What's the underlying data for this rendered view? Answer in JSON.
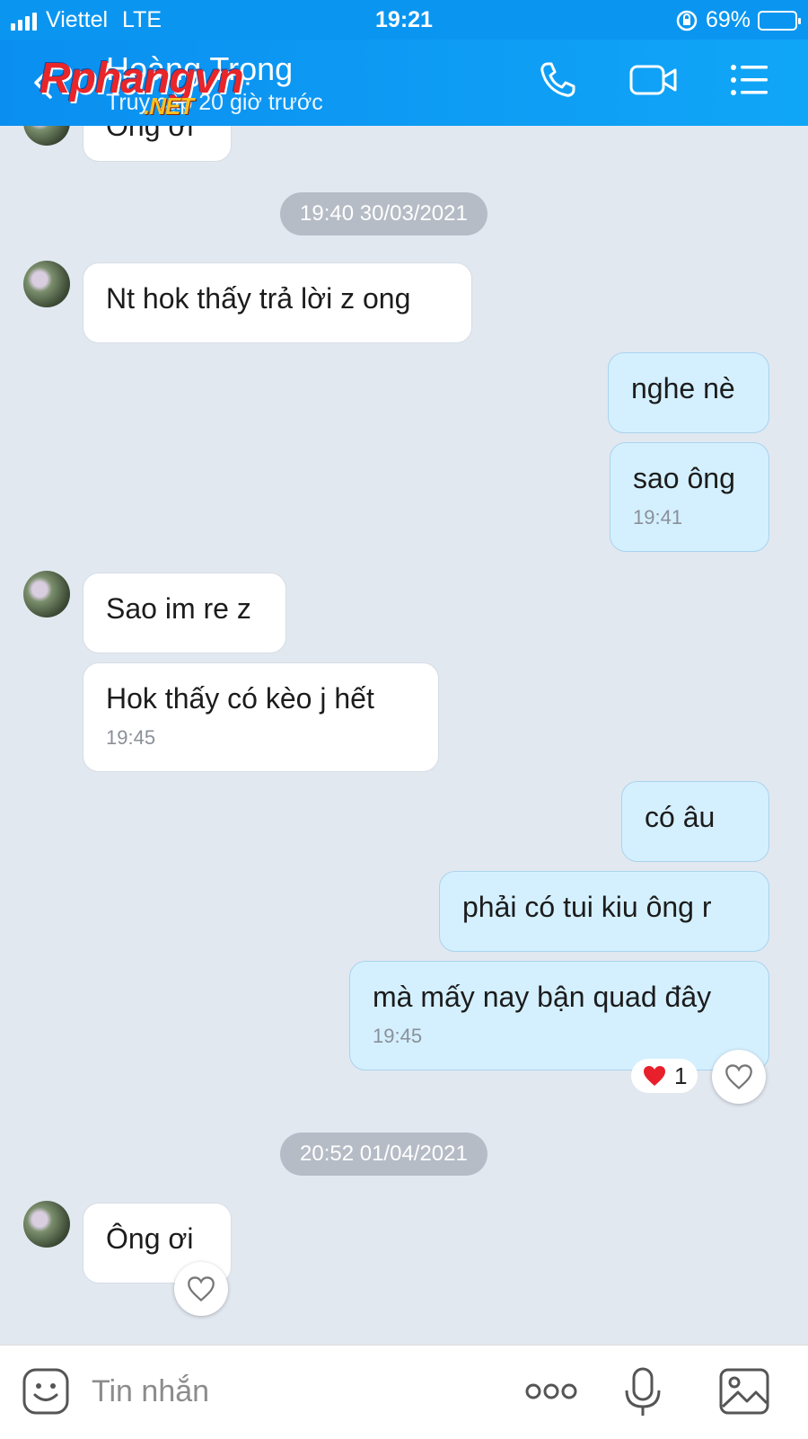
{
  "status_bar": {
    "carrier": "Viettel",
    "network": "LTE",
    "time": "19:21",
    "battery": "69%",
    "battery_level": 0.69
  },
  "header": {
    "contact_name": "Hoàng Trọng",
    "status": "Truy cập 20 giờ trước"
  },
  "watermark": {
    "main": "Rphangvn",
    "sub": ".NET"
  },
  "messages": {
    "m0": {
      "text": "Ông ơi"
    },
    "date1": "19:40 30/03/2021",
    "m1": {
      "text": "Nt hok thấy trả lời z ong"
    },
    "m2": {
      "text": "nghe nè"
    },
    "m3": {
      "text": "sao ông",
      "time": "19:41"
    },
    "m4": {
      "text": "Sao im re z"
    },
    "m5": {
      "text": "Hok thấy có kèo j hết",
      "time": "19:45"
    },
    "m6": {
      "text": "có âu"
    },
    "m7": {
      "text": "phải có tui kiu ông r"
    },
    "m8": {
      "text": "mà mấy nay bận quad đây",
      "time": "19:45"
    },
    "m8_reaction": {
      "emoji": "heart",
      "count": "1"
    },
    "date2": "20:52 01/04/2021",
    "m9": {
      "text": "Ông ơi"
    }
  },
  "input": {
    "placeholder": "Tin nhắn"
  },
  "colors": {
    "header": "#0a96f0",
    "outgoing_bubble": "#d4f0ff",
    "incoming_bubble": "#ffffff",
    "background": "#e2e8f0"
  },
  "icons": [
    "back-icon",
    "phone-icon",
    "video-call-icon",
    "menu-icon",
    "sticker-icon",
    "more-icon",
    "microphone-icon",
    "image-icon",
    "heart-icon"
  ]
}
